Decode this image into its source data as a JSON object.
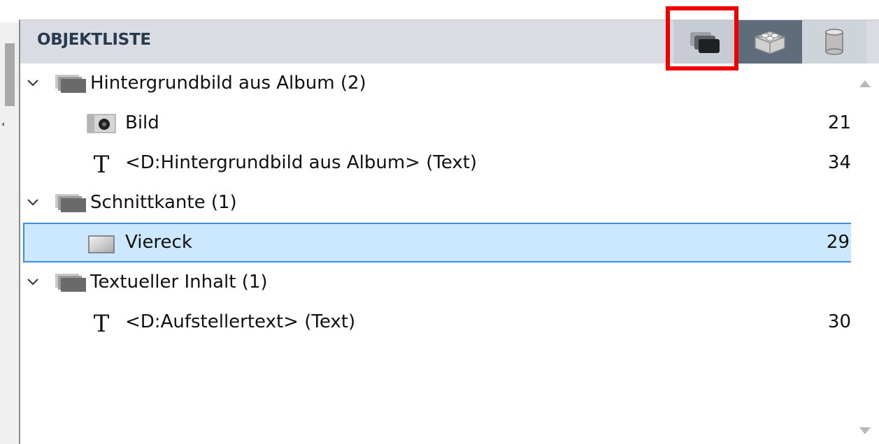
{
  "panel": {
    "title": "OBJEKTLISTE",
    "toolbar": [
      {
        "icon": "layers-icon",
        "state": "active"
      },
      {
        "icon": "lego-brick-icon",
        "state": "normal"
      },
      {
        "icon": "cylinder-icon",
        "state": "normal"
      }
    ],
    "highlight_color": "#ee0000"
  },
  "list": {
    "groups": [
      {
        "label": "Hintergrundbild aus Album (2)",
        "expanded": true,
        "items": [
          {
            "icon": "camera-icon",
            "label": "Bild",
            "number": "21"
          },
          {
            "icon": "text-icon",
            "label": "<D:Hintergrundbild aus Album> (Text)",
            "number": "34"
          }
        ]
      },
      {
        "label": "Schnittkante (1)",
        "expanded": true,
        "items": [
          {
            "icon": "rectangle-icon",
            "label": "Viereck",
            "number": "29",
            "selected": true
          }
        ]
      },
      {
        "label": "Textueller Inhalt (1)",
        "expanded": true,
        "items": [
          {
            "icon": "text-icon",
            "label": "<D:Aufstellertext> (Text)",
            "number": "30"
          }
        ]
      }
    ]
  },
  "colors": {
    "header_bg": "#d9dde3",
    "selection_bg": "#cce8ff",
    "selection_border": "#3d8ee0"
  }
}
